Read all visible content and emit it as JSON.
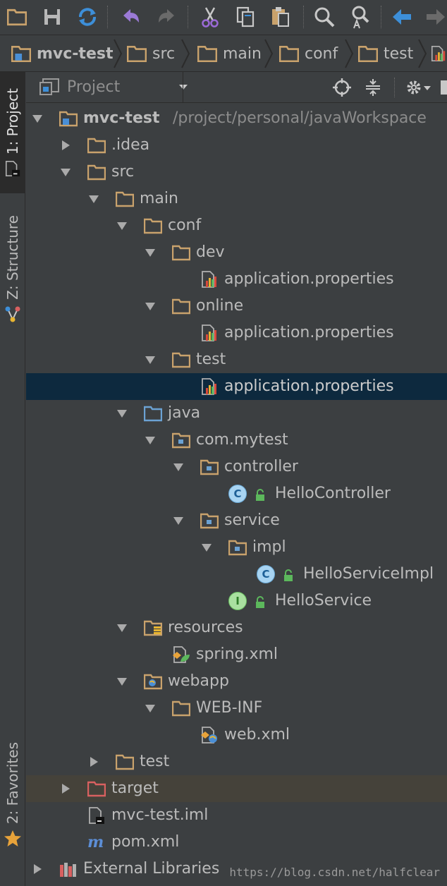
{
  "toolbar": {
    "icons": [
      "open-folder-icon",
      "save-icon",
      "sync-icon",
      "undo-icon",
      "redo-icon",
      "cut-icon",
      "copy-icon",
      "paste-icon",
      "find-icon",
      "replace-icon",
      "back-icon",
      "forward-icon"
    ]
  },
  "breadcrumb": {
    "items": [
      "mvc-test",
      "src",
      "main",
      "conf",
      "test"
    ]
  },
  "sidebar": {
    "project_tab": "1: Project",
    "structure_tab": "Z: Structure",
    "favorites_tab": "2: Favorites"
  },
  "panel": {
    "title": "Project"
  },
  "tree": {
    "root_name": "mvc-test",
    "root_path": "/project/personal/javaWorkspace",
    "idea": ".idea",
    "src": "src",
    "main": "main",
    "conf": "conf",
    "dev": "dev",
    "dev_props": "application.properties",
    "online": "online",
    "online_props": "application.properties",
    "test_conf": "test",
    "test_props": "application.properties",
    "java": "java",
    "package": "com.mytest",
    "controller": "controller",
    "hello_controller": "HelloController",
    "service": "service",
    "impl": "impl",
    "hello_service_impl": "HelloServiceImpl",
    "hello_service": "HelloService",
    "resources": "resources",
    "spring_xml": "spring.xml",
    "webapp": "webapp",
    "webinf": "WEB-INF",
    "web_xml": "web.xml",
    "test": "test",
    "target": "target",
    "iml": "mvc-test.iml",
    "pom": "pom.xml",
    "external": "External Libraries",
    "class_letter": "C",
    "interface_letter": "I"
  },
  "watermark": "https://blog.csdn.net/halfclear",
  "colors": {
    "background": "#3c3f41",
    "selection": "#0d293e",
    "folder": "#c9a26c",
    "source_folder": "#6ba2d3",
    "text": "#bbbbbb"
  }
}
